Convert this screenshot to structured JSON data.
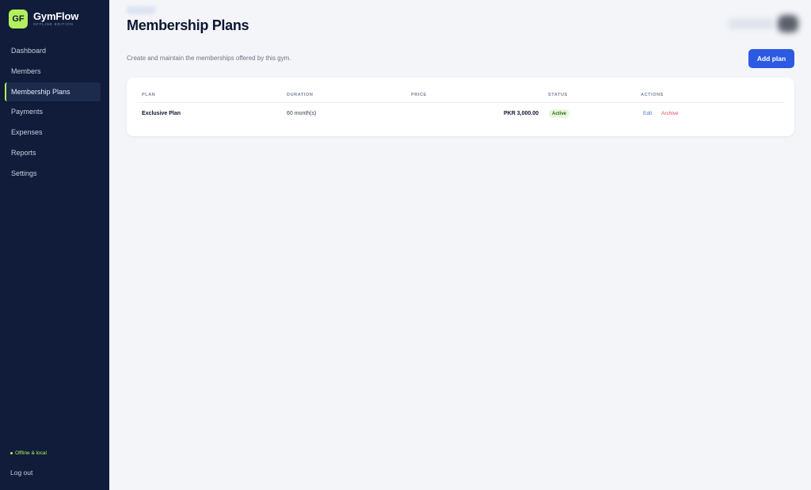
{
  "sidebar": {
    "logo": "GF",
    "app_name": "GymFlow",
    "edition": "OFFLINE EDITION",
    "items": [
      {
        "label": "Dashboard"
      },
      {
        "label": "Members"
      },
      {
        "label": "Membership Plans",
        "active": true
      },
      {
        "label": "Payments"
      },
      {
        "label": "Expenses"
      },
      {
        "label": "Reports"
      },
      {
        "label": "Settings"
      }
    ],
    "status": "Offline & local",
    "logout": "Log out"
  },
  "header": {
    "title": "Membership Plans",
    "subtitle": "Create and maintain the memberships offered by this gym.",
    "add_button": "Add plan"
  },
  "table": {
    "columns": [
      "PLAN",
      "DURATION",
      "PRICE",
      "STATUS",
      "ACTIONS"
    ],
    "rows": [
      {
        "plan": "Exclusive Plan",
        "duration": "60 month(s)",
        "price": "PKR 3,000.00",
        "status": "Active",
        "actions": [
          "Edit",
          "Archive"
        ]
      }
    ]
  },
  "colors": {
    "sidebar_bg": "#101c3a",
    "accent": "#b4ef5c",
    "primary": "#2c5ae3",
    "page_bg": "#f3f5f9",
    "danger": "#e04a5c"
  }
}
